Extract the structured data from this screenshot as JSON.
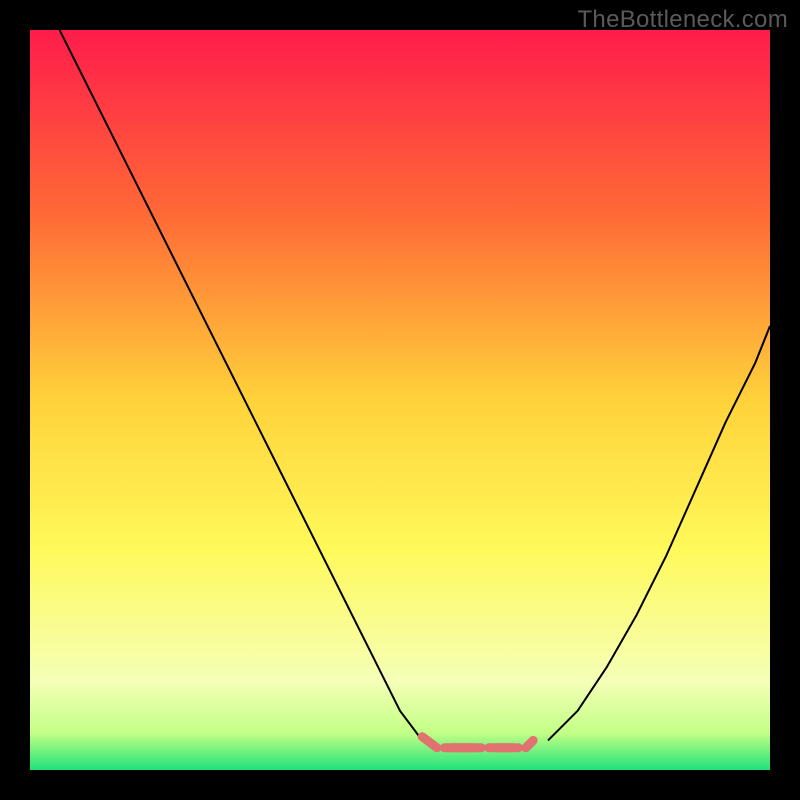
{
  "watermark": "TheBottleneck.com",
  "chart_data": {
    "type": "line",
    "title": "",
    "xlabel": "",
    "ylabel": "",
    "xlim": [
      0,
      100
    ],
    "ylim": [
      0,
      100
    ],
    "background_gradient": {
      "stops": [
        {
          "offset": 0.0,
          "color": "#ff1c4b"
        },
        {
          "offset": 0.25,
          "color": "#ff6a36"
        },
        {
          "offset": 0.5,
          "color": "#ffd23a"
        },
        {
          "offset": 0.7,
          "color": "#fff95a"
        },
        {
          "offset": 0.88,
          "color": "#f5ffb7"
        },
        {
          "offset": 0.95,
          "color": "#c3ff86"
        },
        {
          "offset": 1.0,
          "color": "#1fe27a"
        }
      ]
    },
    "series": [
      {
        "name": "left-branch",
        "color": "#000000",
        "width": 2.0,
        "x": [
          4,
          10,
          16,
          22,
          28,
          34,
          40,
          46,
          50,
          53
        ],
        "y": [
          100,
          88,
          76,
          64,
          52,
          40,
          28,
          16,
          8,
          4
        ]
      },
      {
        "name": "right-branch",
        "color": "#000000",
        "width": 2.0,
        "x": [
          70,
          74,
          78,
          82,
          86,
          90,
          94,
          98,
          100
        ],
        "y": [
          4,
          8,
          14,
          21,
          29,
          38,
          47,
          55,
          60
        ]
      },
      {
        "name": "bottom-band",
        "color": "#e0736f",
        "width": 9.0,
        "linecap": "round",
        "x_segments": [
          [
            53,
            55
          ],
          [
            57,
            60
          ],
          [
            62,
            65
          ],
          [
            67,
            68
          ],
          [
            56,
            61
          ],
          [
            63,
            66
          ]
        ],
        "y_segments": [
          [
            4.5,
            3
          ],
          [
            3,
            3
          ],
          [
            3,
            3
          ],
          [
            3,
            4
          ],
          [
            3,
            3
          ],
          [
            3,
            3
          ]
        ]
      }
    ]
  }
}
